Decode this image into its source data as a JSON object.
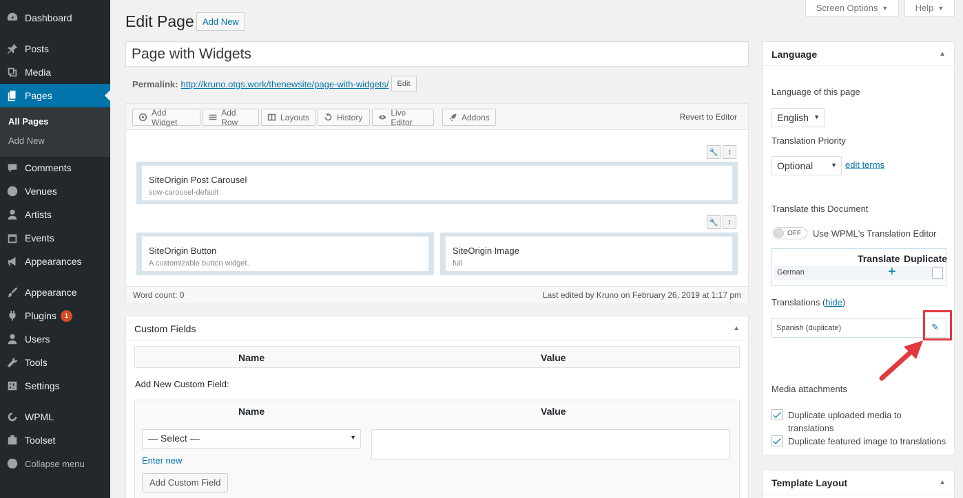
{
  "sidebar": {
    "items": [
      {
        "label": "Dashboard",
        "icon": "dashboard-icon"
      },
      {
        "label": "Posts",
        "icon": "pin-icon"
      },
      {
        "label": "Media",
        "icon": "media-icon"
      },
      {
        "label": "Pages",
        "icon": "pages-icon"
      },
      {
        "label": "Comments",
        "icon": "comment-icon"
      },
      {
        "label": "Venues",
        "icon": "globe-icon"
      },
      {
        "label": "Artists",
        "icon": "user-icon"
      },
      {
        "label": "Events",
        "icon": "calendar-icon"
      },
      {
        "label": "Appearances",
        "icon": "megaphone-icon"
      },
      {
        "label": "Appearance",
        "icon": "brush-icon"
      },
      {
        "label": "Plugins",
        "icon": "plugin-icon",
        "badge": "1"
      },
      {
        "label": "Users",
        "icon": "users-icon"
      },
      {
        "label": "Tools",
        "icon": "wrench-icon"
      },
      {
        "label": "Settings",
        "icon": "settings-icon"
      },
      {
        "label": "WPML",
        "icon": "wpml-icon"
      },
      {
        "label": "Toolset",
        "icon": "toolset-icon"
      }
    ],
    "submenu": [
      "All Pages",
      "Add New"
    ],
    "collapse": "Collapse menu"
  },
  "screen_options": "Screen Options",
  "help": "Help",
  "header": {
    "title": "Edit Page",
    "add_new": "Add New"
  },
  "post_title": "Page with Widgets",
  "permalink": {
    "label": "Permalink:",
    "url_prefix": "http://kruno.otgs.work/thenewsite/",
    "slug": "page-with-widgets",
    "url_suffix": "/",
    "edit": "Edit"
  },
  "builder": {
    "toolbar": [
      "Add Widget",
      "Add Row",
      "Layouts",
      "History",
      "Live Editor",
      "Addons"
    ],
    "revert": "Revert to Editor",
    "widgets": [
      {
        "title": "SiteOrigin Post Carousel",
        "desc": "sow-carousel-default"
      },
      {
        "title": "SiteOrigin Button",
        "desc": "A customizable button widget."
      },
      {
        "title": "SiteOrigin Image",
        "desc": "full"
      }
    ],
    "word_count": "Word count: 0",
    "last_edited": "Last edited by Kruno on February 26, 2019 at 1:17 pm"
  },
  "custom_fields": {
    "title": "Custom Fields",
    "col_name": "Name",
    "col_value": "Value",
    "add_new_label": "Add New Custom Field:",
    "select_placeholder": "— Select —",
    "enter_new": "Enter new",
    "add_button": "Add Custom Field"
  },
  "language_box": {
    "title": "Language",
    "lang_of_page": "Language of this page",
    "language": "English",
    "priority_label": "Translation Priority",
    "priority": "Optional",
    "edit_terms": "edit terms",
    "translate_doc": "Translate this Document",
    "toggle_state": "OFF",
    "toggle_label": "Use WPML's Translation Editor",
    "col_translate": "Translate",
    "col_duplicate": "Duplicate",
    "lang_row": "German",
    "translations_label": "Translations (",
    "hide": "hide",
    "translations_close": ")",
    "translation_item": "Spanish (duplicate)",
    "media_title": "Media attachments",
    "dup_media": "Duplicate uploaded media to translations",
    "dup_featured": "Duplicate featured image to translations"
  },
  "template_layout": "Template Layout",
  "colors": {
    "sidebar_bg": "#23282d",
    "accent": "#0073aa",
    "highlight": "#e03a3e"
  }
}
